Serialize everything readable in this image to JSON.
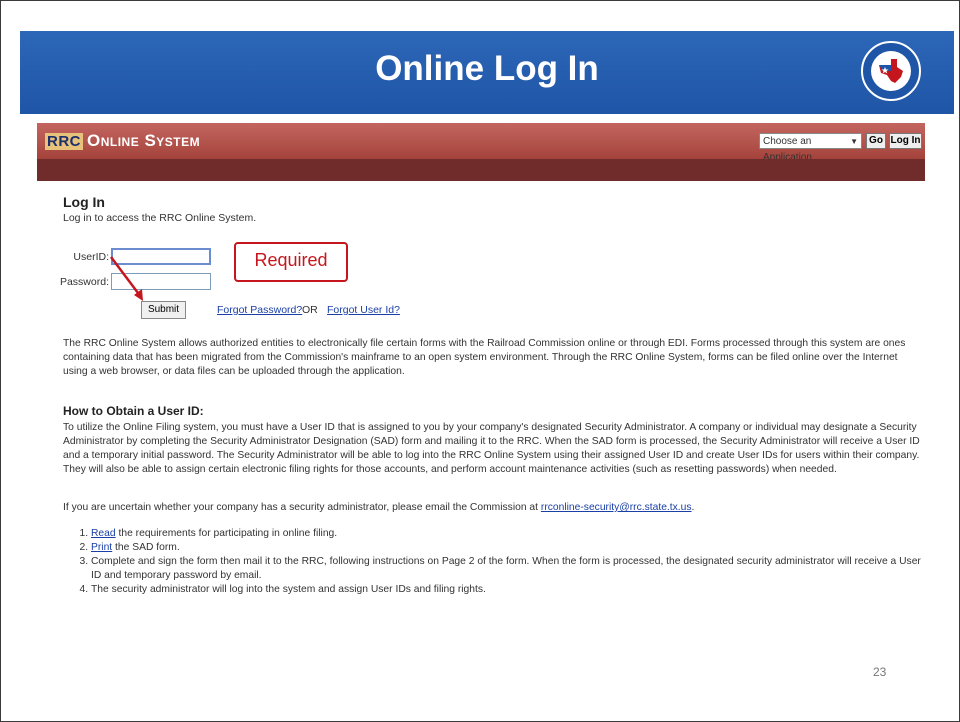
{
  "slide": {
    "title": "Online Log In",
    "page_number": "23"
  },
  "header": {
    "logo_rrc": "RRC",
    "logo_system": "Online System",
    "app_select_value": "Choose an Application",
    "go_label": "Go",
    "login_label": "Log In"
  },
  "login": {
    "heading": "Log In",
    "subtitle": "Log in to access the RRC Online System.",
    "userid_label": "UserID:",
    "password_label": "Password:",
    "submit_label": "Submit",
    "forgot_password": "Forgot Password?",
    "or_text": "OR",
    "forgot_userid": "Forgot User Id?",
    "required_callout": "Required"
  },
  "content": {
    "intro": "The RRC Online System allows authorized entities to electronically file certain forms with the Railroad Commission online or through EDI. Forms processed through this system are ones containing data that has been migrated from the Commission's mainframe to an open system environment. Through the RRC Online System, forms can be filed online over the Internet using a web browser, or data files can be uploaded through the application.",
    "obtain_heading": "How to Obtain a User ID:",
    "obtain_text": "To utilize the Online Filing system, you must have a User ID that is assigned to you by your company's designated Security Administrator. A company or individual may designate a Security Administrator by completing the Security Administrator Designation (SAD) form and mailing it to the RRC. When the SAD form is processed, the Security Administrator will receive a User ID and a temporary initial password. The Security Administrator will be able to log into the RRC Online System using their assigned User ID and create User IDs for users within their company. They will also be able to assign certain electronic filing rights for those accounts, and perform account maintenance activities (such as resetting passwords) when needed.",
    "uncertain_text": "If you are uncertain whether your company has a security administrator, please email the Commission at ",
    "email_link": "rrconline-security@rrc.state.tx.us",
    "uncertain_end": ".",
    "steps": [
      {
        "link": "Read",
        "text": " the requirements for participating in online filing."
      },
      {
        "link": "Print",
        "text": " the SAD form."
      },
      {
        "link": "",
        "text": "Complete and sign the form then mail it to the RRC, following instructions on Page 2 of the form. When the form is processed, the designated security administrator will receive a User ID and temporary password by email."
      },
      {
        "link": "",
        "text": "The security administrator will log into the system and assign User IDs and filing rights."
      }
    ]
  },
  "colors": {
    "banner": "#1f55a6",
    "header_top": "#c3665f",
    "header_bar": "#6f2c2a",
    "callout": "#c4161c",
    "link": "#1a3fa6"
  }
}
